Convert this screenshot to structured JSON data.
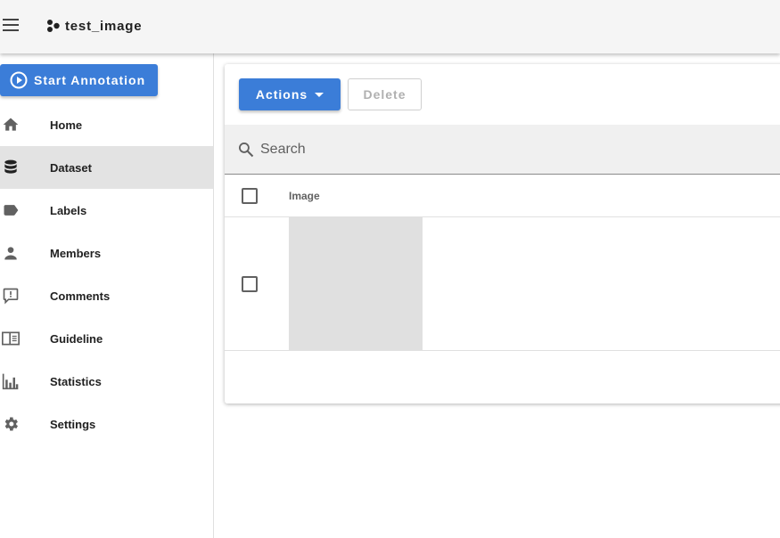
{
  "app": {
    "project_title": "test_image"
  },
  "sidebar": {
    "start_annotation_label": "Start Annotation",
    "items": [
      {
        "label": "Home",
        "icon": "home-icon",
        "active": false
      },
      {
        "label": "Dataset",
        "icon": "database-icon",
        "active": true
      },
      {
        "label": "Labels",
        "icon": "label-icon",
        "active": false
      },
      {
        "label": "Members",
        "icon": "person-icon",
        "active": false
      },
      {
        "label": "Comments",
        "icon": "comment-icon",
        "active": false
      },
      {
        "label": "Guideline",
        "icon": "book-icon",
        "active": false
      },
      {
        "label": "Statistics",
        "icon": "chart-icon",
        "active": false
      },
      {
        "label": "Settings",
        "icon": "gear-icon",
        "active": false
      }
    ]
  },
  "toolbar": {
    "actions_label": "Actions",
    "delete_label": "Delete"
  },
  "search": {
    "placeholder": "Search",
    "value": ""
  },
  "table": {
    "columns": [
      "Image"
    ],
    "rows": [
      {
        "image": "",
        "checked": false
      }
    ]
  },
  "colors": {
    "primary": "#3b7dd8",
    "appbar": "#f5f5f5",
    "active_nav": "#e3e3e3",
    "thumbnail": "#e0e0e0"
  }
}
